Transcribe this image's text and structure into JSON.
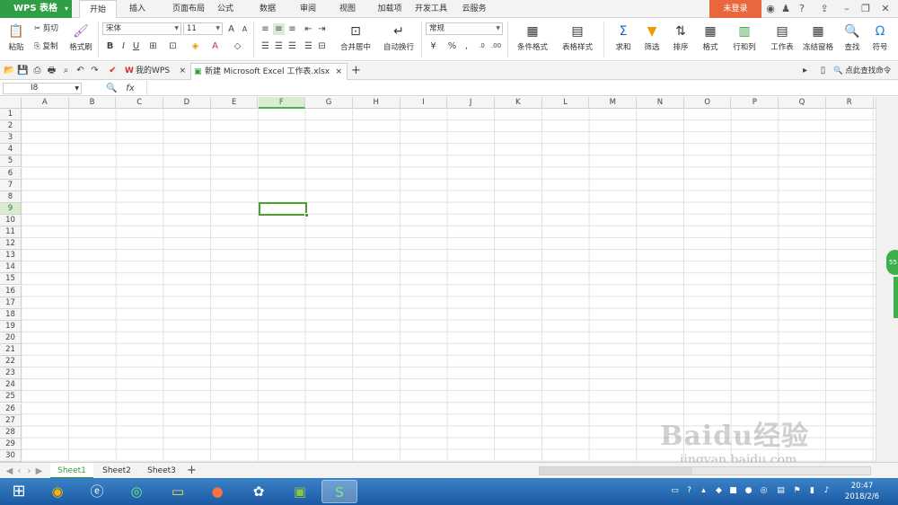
{
  "app": {
    "name": "WPS 表格",
    "brand_color": "#2f9e44",
    "login": "未登录"
  },
  "menu": [
    "开始",
    "插入",
    "页面布局",
    "公式",
    "数据",
    "审阅",
    "视图",
    "加载项",
    "开发工具",
    "云服务"
  ],
  "ribbon": {
    "paste": "粘贴",
    "cut": "剪切",
    "copy": "复制",
    "format_painter": "格式刷",
    "font_name": "宋体",
    "font_size": "11",
    "bold": "B",
    "italic": "I",
    "underline": "U",
    "merge_center": "合并居中",
    "wrap_text": "自动换行",
    "number_format": "常规",
    "percent": "%",
    "conditional_format": "条件格式",
    "table_style": "表格样式",
    "sum": "求和",
    "filter": "筛选",
    "sort": "排序",
    "format": "格式",
    "row_col": "行和列",
    "worksheet": "工作表",
    "freeze": "冻结窗格",
    "find": "查找",
    "symbol": "符号"
  },
  "tabs": {
    "home": "我的WPS",
    "file": "新建 Microsoft Excel 工作表.xlsx",
    "search": "点此查找命令"
  },
  "formula": {
    "cell": "I8",
    "fx": "fx"
  },
  "grid": {
    "columns": [
      "A",
      "B",
      "C",
      "D",
      "E",
      "F",
      "G",
      "H",
      "I",
      "J",
      "K",
      "L",
      "M",
      "N",
      "O",
      "P",
      "Q",
      "R"
    ],
    "rows": [
      "1",
      "2",
      "3",
      "4",
      "5",
      "6",
      "7",
      "8",
      "9",
      "10",
      "11",
      "12",
      "13",
      "14",
      "15",
      "16",
      "17",
      "18",
      "19",
      "20",
      "21",
      "22",
      "23",
      "24",
      "25",
      "26",
      "27",
      "28",
      "29",
      "30"
    ],
    "selected_col": "F",
    "selected_row": "9"
  },
  "sheets": [
    "Sheet1",
    "Sheet2",
    "Sheet3"
  ],
  "side_badge": "55",
  "clock": {
    "time": "20:47",
    "date": "2018/2/6"
  },
  "watermark": {
    "brand": "Baidu经验",
    "url": "jingyan.baidu.com"
  }
}
